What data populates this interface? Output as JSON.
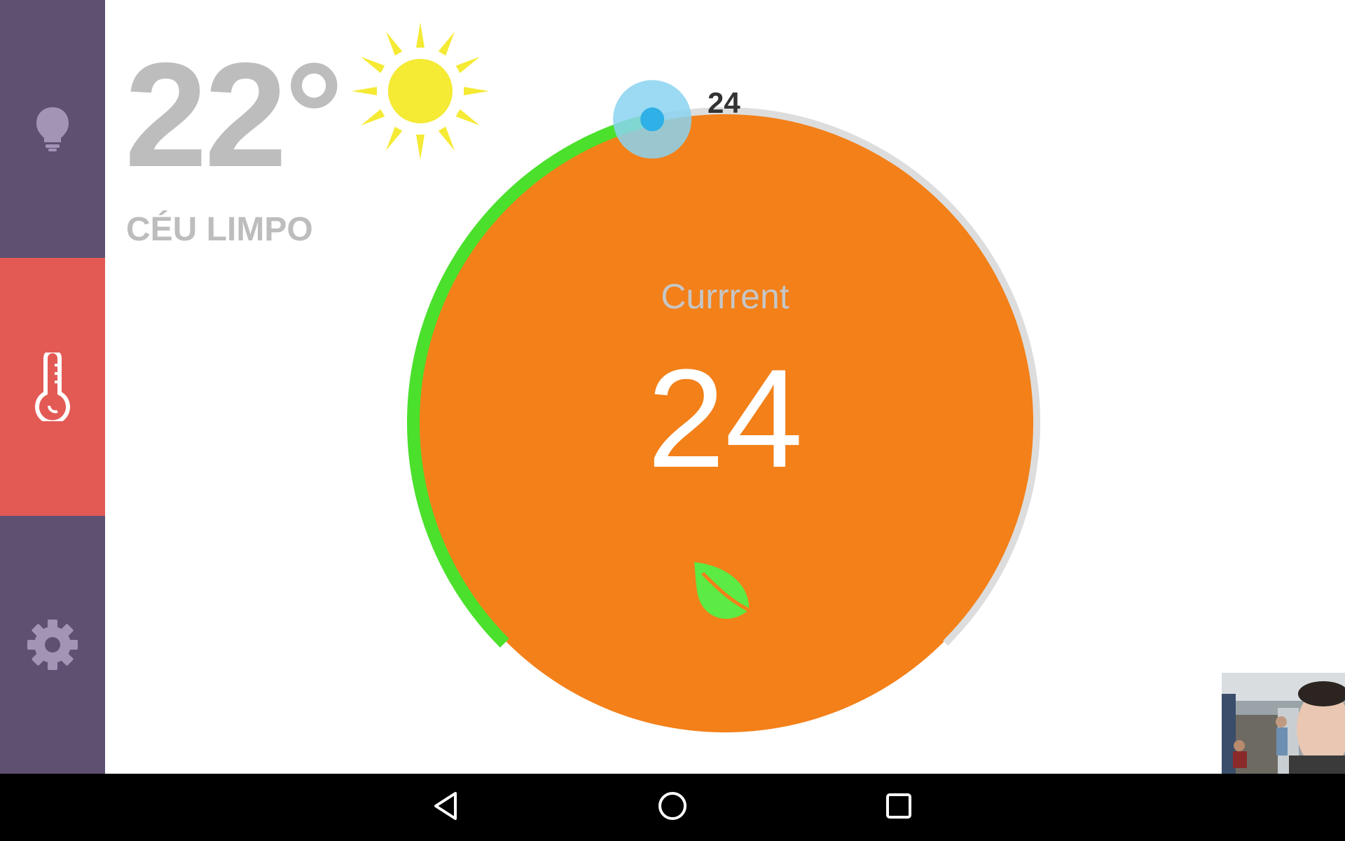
{
  "colors": {
    "sidebar": "#5e5070",
    "sidebar_active": "#e35a55",
    "sidebar_icon": "#a394b6",
    "dial_fill": "#f38019",
    "dial_track": "#dddddd",
    "dial_progress": "#4be02c",
    "knob": "#8ad3f0",
    "knob_center": "#2fb0e6",
    "sun": "#f5ea34",
    "leaf": "#5cea44",
    "muted_text": "#bdbdbd"
  },
  "sidebar": {
    "items": [
      {
        "name": "lights",
        "icon": "lightbulb-icon",
        "active": false
      },
      {
        "name": "temperature",
        "icon": "thermometer-icon",
        "active": true
      },
      {
        "name": "settings",
        "icon": "gear-icon",
        "active": false
      }
    ]
  },
  "weather": {
    "temperature": "22°",
    "condition": "CÉU LIMPO",
    "icon": "sun-icon"
  },
  "thermostat": {
    "label": "Currrent",
    "current": "24",
    "setpoint": "24",
    "setpoint_fraction": 0.45,
    "mode_icon": "leaf-icon"
  },
  "nav": {
    "buttons": [
      "back-icon",
      "home-icon",
      "recents-icon"
    ]
  },
  "video_thumbnail": {
    "icon": "camera-preview"
  }
}
